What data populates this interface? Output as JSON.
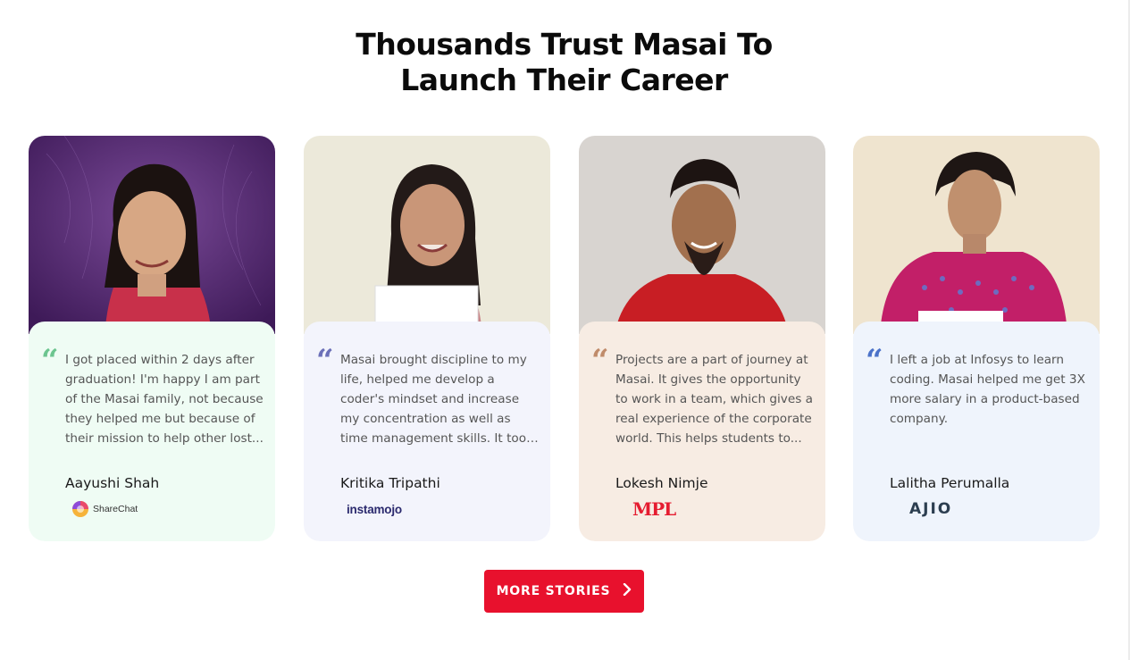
{
  "heading": {
    "line1": "Thousands Trust Masai To",
    "line2": "Launch Their Career"
  },
  "colors": {
    "accent": "#e8112d"
  },
  "cards": [
    {
      "quote": "I got placed within 2 days after graduation! I'm happy I am part of the Masai family, not because they helped me but because of their mission to help other lost...",
      "name": "Aayushi Shah",
      "company": "ShareChat",
      "bg": "#effcf4",
      "quote_color": "#6cc58f",
      "photo_bg": "#5a2a78"
    },
    {
      "quote": "Masai brought discipline to my life, helped me develop a coder's mindset and increase my concentration as well as time management skills. It took me...",
      "name": "Kritika Tripathi",
      "company": "instamojo",
      "bg": "#f3f4fc",
      "quote_color": "#6b6fb8",
      "photo_bg": "#ece9da"
    },
    {
      "quote": "Projects are a part of journey at Masai. It gives the opportunity to work in a team, which gives a real experience of the corporate world. This helps students to...",
      "name": "Lokesh Nimje",
      "company": "MPL",
      "bg": "#f7ece3",
      "quote_color": "#c08b6a",
      "photo_bg": "#d8d4d0"
    },
    {
      "quote": "I left a job at Infosys to learn coding. Masai helped me get 3X more salary in a product-based company.",
      "name": "Lalitha Perumalla",
      "company": "AJIO",
      "bg": "#eff4fc",
      "quote_color": "#4b72c9",
      "photo_bg": "#efe4cf"
    }
  ],
  "more_button": {
    "label": "MORE STORIES",
    "icon": "chevron-right-icon"
  }
}
